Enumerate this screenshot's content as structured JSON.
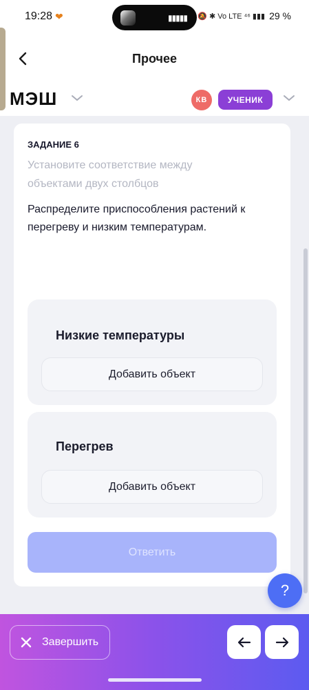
{
  "status_bar": {
    "time": "19:28",
    "heart_icon": "heart-icon",
    "right_icons": "🔕 ✱ Vo LTE ⁴⁶ ▮▮▮",
    "battery": "29 %"
  },
  "header": {
    "title": "Прочее",
    "brand": "МЭШ",
    "avatar_initials": "КВ",
    "role": "УЧЕНИК",
    "colors": {
      "avatar": "#ee6b67",
      "role": "#8b3fd6"
    }
  },
  "task": {
    "label": "ЗАДАНИЕ 6",
    "hint": "Установите соответствие между объектами двух столбцов",
    "text": "Распределите приспособления растений к перегреву и низким температурам."
  },
  "groups": [
    {
      "title": "Низкие температуры",
      "add_label": "Добавить объект"
    },
    {
      "title": "Перегрев",
      "add_label": "Добавить объект"
    }
  ],
  "answer_button": "Ответить",
  "help_button": "?",
  "bottom_bar": {
    "finish_label": "Завершить",
    "prev_icon": "arrow-left-icon",
    "next_icon": "arrow-right-icon"
  }
}
